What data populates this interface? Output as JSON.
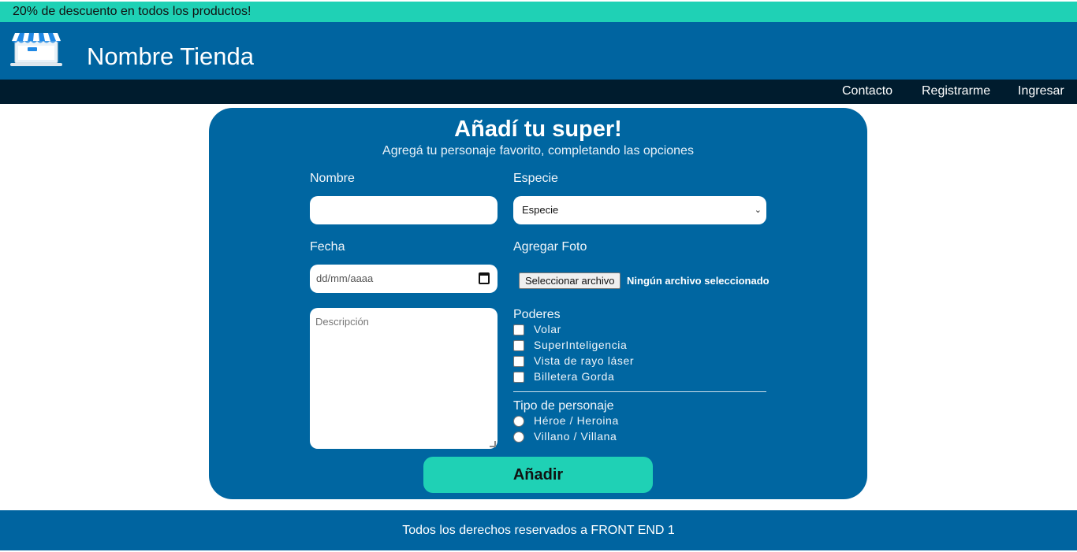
{
  "promo": {
    "text": "20% de descuento en todos los productos!"
  },
  "header": {
    "store_name": "Nombre Tienda"
  },
  "nav": {
    "items": [
      "Contacto",
      "Registrarme",
      "Ingresar"
    ]
  },
  "form": {
    "title": "Añadí tu super!",
    "subtitle": "Agregá tu personaje favorito, completando las opciones",
    "nombre_label": "Nombre",
    "nombre_value": "",
    "especie_label": "Especie",
    "especie_selected": "Especie",
    "fecha_label": "Fecha",
    "fecha_placeholder": "dd/mm/aaaa",
    "foto_label": "Agregar Foto",
    "file_button": "Seleccionar archivo",
    "file_status": "Ningún archivo seleccionado",
    "descripcion_placeholder": "Descripción",
    "poderes_label": "Poderes",
    "poderes": [
      "Volar",
      "SuperInteligencia",
      "Vista de rayo láser",
      "Billetera Gorda"
    ],
    "tipo_label": "Tipo de personaje",
    "tipos": [
      "Héroe / Heroina",
      "Villano / Villana"
    ],
    "submit_label": "Añadir"
  },
  "footer": {
    "text": "Todos los derechos reservados a FRONT END 1"
  },
  "colors": {
    "accent": "#1fd1b5",
    "primary": "#0064a0",
    "nav_bg": "#001c2e"
  }
}
